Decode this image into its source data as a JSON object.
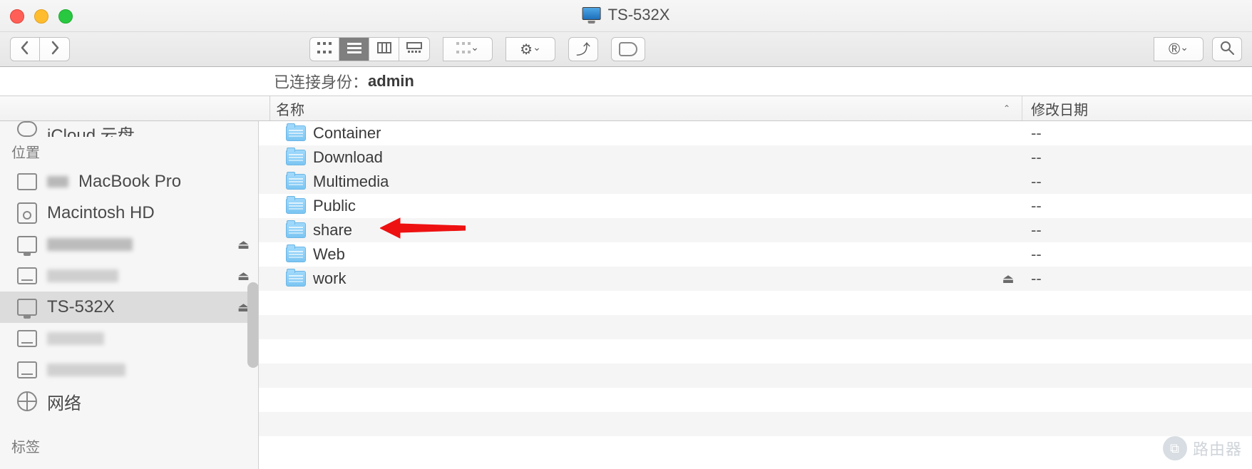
{
  "window": {
    "title": "TS-532X"
  },
  "status": {
    "prefix": "已连接身份：",
    "user": "admin"
  },
  "columns": {
    "name": "名称",
    "date": "修改日期"
  },
  "sidebar": {
    "partial_top": "iCloud 云盘",
    "heading_locations": "位置",
    "heading_tags": "标签",
    "items": [
      {
        "label": "MacBook Pro",
        "icon": "laptop",
        "eject": false,
        "blurred_prefix": true
      },
      {
        "label": "Macintosh HD",
        "icon": "disk",
        "eject": false
      },
      {
        "label": "",
        "icon": "monitor",
        "eject": true,
        "blurred": true
      },
      {
        "label": "",
        "icon": "drive",
        "eject": true,
        "blurred": true
      },
      {
        "label": "TS-532X",
        "icon": "monitor",
        "eject": true,
        "selected": true
      },
      {
        "label": "",
        "icon": "drive",
        "eject": false,
        "blurred": true
      },
      {
        "label": "",
        "icon": "drive",
        "eject": false,
        "blurred": true
      },
      {
        "label": "网络",
        "icon": "globe",
        "eject": false
      }
    ]
  },
  "files": [
    {
      "name": "Container",
      "date": "--",
      "eject": false
    },
    {
      "name": "Download",
      "date": "--",
      "eject": false
    },
    {
      "name": "Multimedia",
      "date": "--",
      "eject": false
    },
    {
      "name": "Public",
      "date": "--",
      "eject": false
    },
    {
      "name": "share",
      "date": "--",
      "eject": false
    },
    {
      "name": "Web",
      "date": "--",
      "eject": false
    },
    {
      "name": "work",
      "date": "--",
      "eject": true
    }
  ],
  "watermark": "路由器",
  "icons": {
    "eject": "⏏"
  }
}
